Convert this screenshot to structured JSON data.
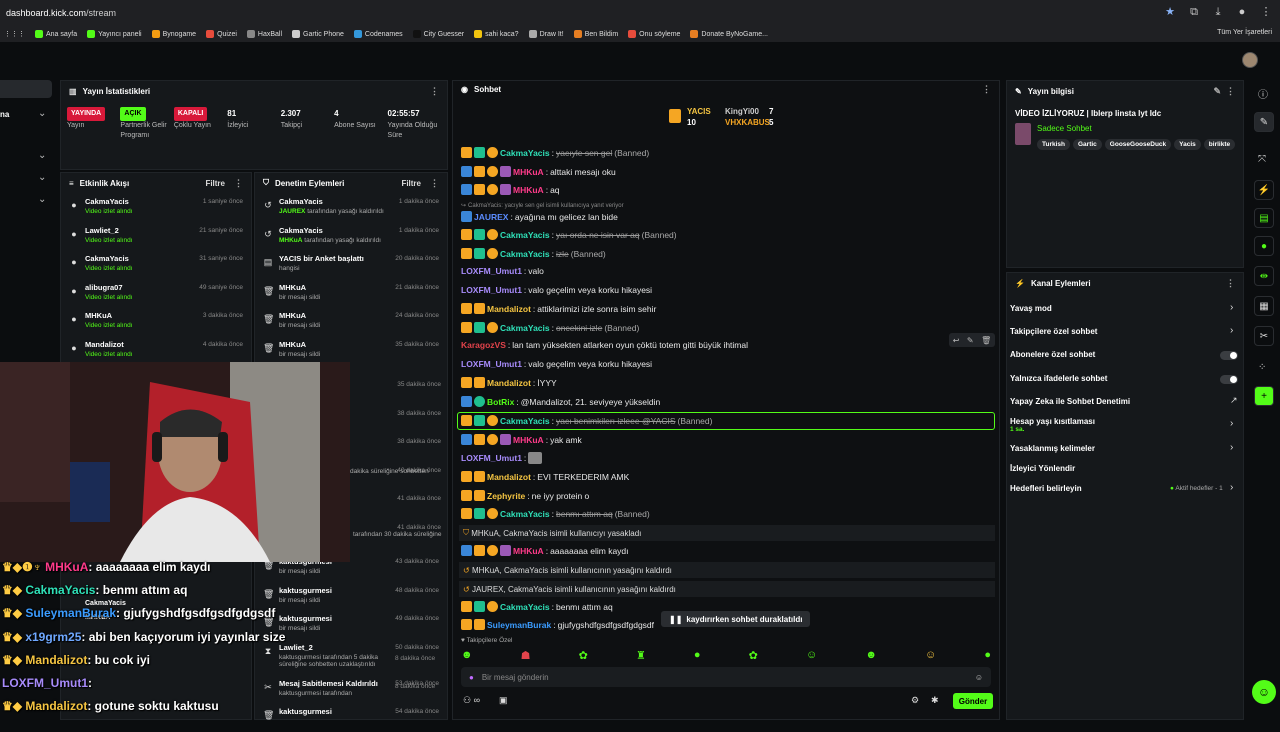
{
  "browser": {
    "url_host": "dashboard.kick.com",
    "url_path": "/stream",
    "bookmarks": [
      "Ana sayfa",
      "Yayıncı paneli",
      "Bynogame",
      "Quizei",
      "HaxBall",
      "Gartic Phone",
      "Codenames",
      "City Guesser",
      "sahi kaca?",
      "Draw It!",
      "Ben Bildim",
      "Onu söyleme",
      "Donate ByNoGame..."
    ],
    "bookmarks_right": "Tüm Yer İşaretleri"
  },
  "left_nav": {
    "partial_label": "na"
  },
  "stats_panel": {
    "title": "Yayın İstatistikleri",
    "items": [
      {
        "value": "YAYINDA",
        "label": "Yayın",
        "kind": "red"
      },
      {
        "value": "AÇIK",
        "label": "Partnerlik Gelir Programı",
        "kind": "green"
      },
      {
        "value": "KAPALI",
        "label": "Çoklu Yayın",
        "kind": "red"
      },
      {
        "value": "81",
        "label": "İzleyici"
      },
      {
        "value": "2.307",
        "label": "Takipçi"
      },
      {
        "value": "4",
        "label": "Abone Sayısı"
      },
      {
        "value": "02:55:57",
        "label": "Yayında Olduğu Süre"
      }
    ]
  },
  "activity_feed": {
    "title": "Etkinlik Akışı",
    "filter": "Filtre",
    "items": [
      {
        "name": "CakmaYacis",
        "sub": "Video izlet alındı",
        "time": "1 saniye önce"
      },
      {
        "name": "Lawliet_2",
        "sub": "Video izlet alındı",
        "time": "21 saniye önce"
      },
      {
        "name": "CakmaYacis",
        "sub": "Video izlet alındı",
        "time": "31 saniye önce"
      },
      {
        "name": "alibugra07",
        "sub": "Video izlet alındı",
        "time": "49 saniye önce"
      },
      {
        "name": "MHKuA",
        "sub": "Video izlet alındı",
        "time": "3 dakika önce"
      },
      {
        "name": "Mandalizot",
        "sub": "Video izlet alındı",
        "time": "4 dakika önce"
      }
    ],
    "lower": [
      {
        "name": "CakmaYacis",
        "sub": "Video izlet alındı"
      },
      {
        "name": "MHKuA",
        "sub": "Video izlet alındı"
      },
      {
        "name": "CakmaYacis",
        "sub": "Video izlet alındı"
      },
      {
        "name": "Video izlet alındı",
        "sub": ""
      }
    ]
  },
  "moderation": {
    "title": "Denetim Eylemleri",
    "filter": "Filtre",
    "items": [
      {
        "name": "CakmaYacis",
        "by": "JAUREX",
        "rest": "tarafından yasağı kaldırıldı",
        "time": "1 dakika önce",
        "icon": "↺"
      },
      {
        "name": "CakmaYacis",
        "by": "MHKuA",
        "rest": "tarafından yasağı kaldırıldı",
        "time": "1 dakika önce",
        "icon": "↺"
      },
      {
        "name": "YACIS bir Anket başlattı",
        "by": "",
        "rest": "hangisi",
        "time": "20 dakika önce",
        "icon": "▤"
      },
      {
        "name": "MHKuA",
        "by": "",
        "rest": "bir mesajı sildi",
        "time": "21 dakika önce",
        "icon": "🗑"
      },
      {
        "name": "MHKuA",
        "by": "",
        "rest": "bir mesajı sildi",
        "time": "24 dakika önce",
        "icon": "🗑"
      },
      {
        "name": "MHKuA",
        "by": "",
        "rest": "bir mesajı sildi",
        "time": "35 dakika önce",
        "icon": "🗑"
      }
    ],
    "times_hidden": [
      "35 dakika önce",
      "38 dakika önce",
      "38 dakika önce",
      "40 dakika önce",
      "41 dakika önce",
      "41 dakika önce"
    ],
    "partial_text_1": "dakika süreliğine sohbetten",
    "partial_text_2": "tarafından 30 dakika süreliğine",
    "lower": [
      {
        "name": "kaktusgurmesi",
        "rest": "bir mesajı sildi",
        "time": "43 dakika önce",
        "icon": "🗑"
      },
      {
        "name": "kaktusgurmesi",
        "rest": "bir mesajı sildi",
        "time": "48 dakika önce",
        "icon": "🗑"
      },
      {
        "name": "kaktusgurmesi",
        "rest": "bir mesajı sildi",
        "time": "49 dakika önce",
        "icon": "🗑"
      },
      {
        "name": "Lawliet_2",
        "rest": "kaktusgurmesi tarafından 5 dakika süreliğine sohbetten uzaklaştırıldı",
        "time": "50 dakika önce",
        "icon": "⧗"
      },
      {
        "name": "Mesaj Sabitlemesi Kaldırıldı",
        "rest": "kaktusgurmesi tarafından",
        "time": "53 dakika önce",
        "icon": "✂"
      },
      {
        "name": "kaktusgurmesi",
        "rest": "",
        "time": "54 dakika önce",
        "icon": "🗑"
      }
    ],
    "lower_times_extra": [
      "8 dakika önce",
      "8 dakika önce"
    ]
  },
  "overlay_chat": [
    {
      "user": "MHKuA",
      "text": "aaaaaaaa elim kaydı",
      "color": "#ff3b8a"
    },
    {
      "user": "CakmaYacis",
      "text": "benmı attım aq",
      "color": "#2fe0b8"
    },
    {
      "user": "SuleymanBurak",
      "text": "gjufygshdfgsdfgsdfgdgsdf",
      "color": "#3b9cff"
    },
    {
      "user": "x19grm25",
      "text": "abi ben kaçıyorum iyi yayınlar size",
      "color": "#6fa8ff"
    },
    {
      "user": "Mandalizot",
      "text": "bu cok iyi",
      "color": "#f5c542"
    },
    {
      "user": "LOXFM_Umut1",
      "text": "",
      "color": "#a78bfa"
    },
    {
      "user": "Mandalizot",
      "text": "gotune soktu kaktusu",
      "color": "#f5c542"
    }
  ],
  "chat": {
    "title": "Sohbet",
    "leaderboard": {
      "first_name": "YACIS",
      "first_count": "10",
      "second_name": "KingYi00",
      "second_count": "7",
      "third_name": "VHXKABUS",
      "third_count": "5"
    },
    "messages": [
      {
        "user": "CakmaYacis",
        "text": "yacıyle sen gel",
        "banned": true,
        "color": "#2fe0b8"
      },
      {
        "user": "MHKuA",
        "text": "alttaki mesajı oku",
        "color": "#ff3b8a"
      },
      {
        "user": "MHKuA",
        "text": "aq",
        "color": "#ff3b8a"
      },
      {
        "reply": "CakmaYacis: yacıyle sen gel isimli kullanıcıya yanıt veriyor",
        "user": "JAUREX",
        "text": "ayağına mı gelicez lan bide",
        "color": "#5b8cff"
      },
      {
        "user": "CakmaYacis",
        "text": "yaı orda ne isin var aq",
        "banned": true,
        "color": "#2fe0b8"
      },
      {
        "user": "CakmaYacis",
        "text": "izle",
        "banned": true,
        "color": "#2fe0b8"
      },
      {
        "user": "LOXFM_Umut1",
        "text": "valo",
        "color": "#a78bfa"
      },
      {
        "user": "LOXFM_Umut1",
        "text": "valo geçelim veya korku hikayesi",
        "color": "#a78bfa"
      },
      {
        "user": "Mandalizot",
        "text": "attiklarimizi izle sonra isim sehir",
        "color": "#f5c542"
      },
      {
        "user": "CakmaYacis",
        "text": "oncekini izle",
        "banned": true,
        "color": "#2fe0b8"
      },
      {
        "user": "KaragozVS",
        "text": "lan tam yüksekten atlarken oyun çöktü totem gitti büyük ihtimal",
        "color": "#e2434b"
      },
      {
        "user": "LOXFM_Umut1",
        "text": "valo geçelim veya korku hikayesi",
        "color": "#a78bfa"
      },
      {
        "user": "Mandalizot",
        "text": "İYYY",
        "color": "#f5c542"
      },
      {
        "user": "BotRix",
        "text": "@Mandalizot, 21. seviyeye yükseldin",
        "color": "#53fc18"
      },
      {
        "user": "CakmaYacis",
        "text": "yacı benimkilerı izleee @YACIS",
        "banned": true,
        "color": "#2fe0b8"
      },
      {
        "user": "MHKuA",
        "text": "yak amk",
        "color": "#ff3b8a"
      },
      {
        "user": "LOXFM_Umut1",
        "text": "",
        "color": "#a78bfa"
      },
      {
        "user": "Mandalizot",
        "text": "EVI TERKEDERIM AMK",
        "color": "#f5c542"
      },
      {
        "user": "Zephyrite",
        "text": "ne iyy protein o",
        "color": "#f5c542"
      },
      {
        "user": "CakmaYacis",
        "text": "benmı attım aq",
        "banned": true,
        "color": "#2fe0b8"
      },
      {
        "user": "MHKuA",
        "text": "aaaaaaaa elim kaydı",
        "color": "#ff3b8a"
      },
      {
        "user": "CakmaYacis",
        "text": "benmı attım aq",
        "color": "#2fe0b8"
      },
      {
        "user": "SuleymanBurak",
        "text": "gjufygshdfgsdfgsdfgdgsdf",
        "color": "#3b9cff"
      }
    ],
    "banned_label": "(Banned)",
    "system": [
      "MHKuA, CakmaYacis isimli kullanıcıyı yasakladı",
      "MHKuA, CakmaYacis isimli kullanıcının yasağını kaldırdı",
      "JAUREX, CakmaYacis isimli kullanıcının yasağını kaldırdı"
    ],
    "paused_label": "kaydırırken sohbet duraklatıldı",
    "follower_only": "Takipçilere Özel",
    "input_placeholder": "Bir mesaj gönderin",
    "send_label": "Gönder"
  },
  "stream_info": {
    "title": "Yayın bilgisi",
    "stream_title": "VİDEO İZLİYORUZ | Iblerp Iinsta Iyt Idc",
    "category": "Sadece Sohbet",
    "tags": [
      "Turkish",
      "Gartic",
      "GooseGooseDuck",
      "Yacis",
      "birlikte"
    ]
  },
  "channel_actions": {
    "title": "Kanal Eylemleri",
    "rows": [
      {
        "label": "Yavaş mod",
        "ctrl": "chevron"
      },
      {
        "label": "Takipçilere özel sohbet",
        "ctrl": "chevron"
      },
      {
        "label": "Abonelere özel sohbet",
        "ctrl": "toggle"
      },
      {
        "label": "Yalnızca ifadelerle sohbet",
        "ctrl": "toggle"
      },
      {
        "label": "Yapay Zeka ile Sohbet Denetimi",
        "ctrl": "external"
      },
      {
        "label": "Hesap yaşı kısıtlaması",
        "sub": "1 sa.",
        "ctrl": "chevron"
      },
      {
        "label": "Yasaklanmış kelimeler",
        "ctrl": "chevron"
      },
      {
        "label": "İzleyici Yönlendir",
        "ctrl": ""
      },
      {
        "label": "Hedefleri belirleyin",
        "ctrl": "chevron",
        "extra": "Aktif hedefler - 1"
      }
    ]
  }
}
